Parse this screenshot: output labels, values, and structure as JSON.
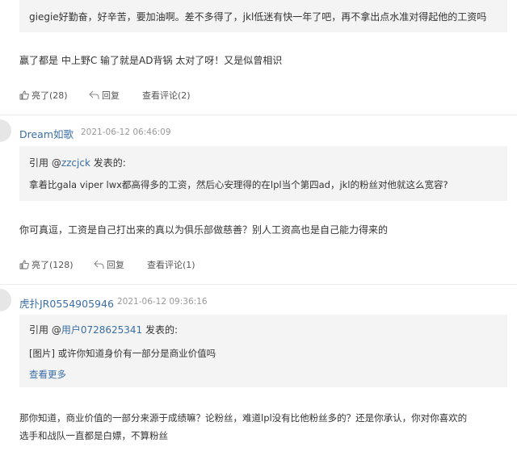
{
  "comment0": {
    "quote_text": "giegie好勤奋，好辛苦，要加油啊。差不多得了，jkl低迷有快一年了吧，再不拿出点水准对得起他的工资吗",
    "body": "赢了都是 中上野C  输了就是AD背锅   太对了呀！又是似曾相识",
    "like_label": "亮了(28)",
    "reply_label": "回复",
    "view_label": "查看评论(2)"
  },
  "comment1": {
    "username": "Dream如歌",
    "timestamp": "2021-06-12 06:46:09",
    "quote_prefix": "引用 @",
    "quote_user": "zzcjck",
    "quote_suffix": " 发表的:",
    "quote_text": "拿着比gala viper lwx都高得多的工资，然后心安理得的在lpl当个第四ad，jkl的粉丝对他就这么宽容?",
    "body": "你可真逗，工资是自己打出来的真以为俱乐部做慈善？别人工资高也是自己能力得来的",
    "like_label": "亮了(128)",
    "reply_label": "回复",
    "view_label": "查看评论(1)"
  },
  "comment2": {
    "username": "虎扑JR0554905946",
    "timestamp": "2021-06-12 09:36:16",
    "quote_prefix": "引用 @",
    "quote_user": "用户0728625341",
    "quote_suffix": " 发表的:",
    "quote_text": "[图片] 或许你知道身价有一部分是商业价值吗",
    "see_more": "查看更多",
    "body_line1": "那你知道，商业价值的一部分来源于成绩嘛？论粉丝，难道lpl没有比他粉丝多的？还是你承认，你对你喜欢的",
    "body_line2": "选手和战队一直都是白嫖，不算粉丝"
  },
  "colors": {
    "link": "#3a6ea5",
    "quote_bg": "#f4f4f4",
    "meta": "#999999"
  },
  "icons": [
    "thumbs-up-icon",
    "reply-icon",
    "avatar-icon"
  ]
}
